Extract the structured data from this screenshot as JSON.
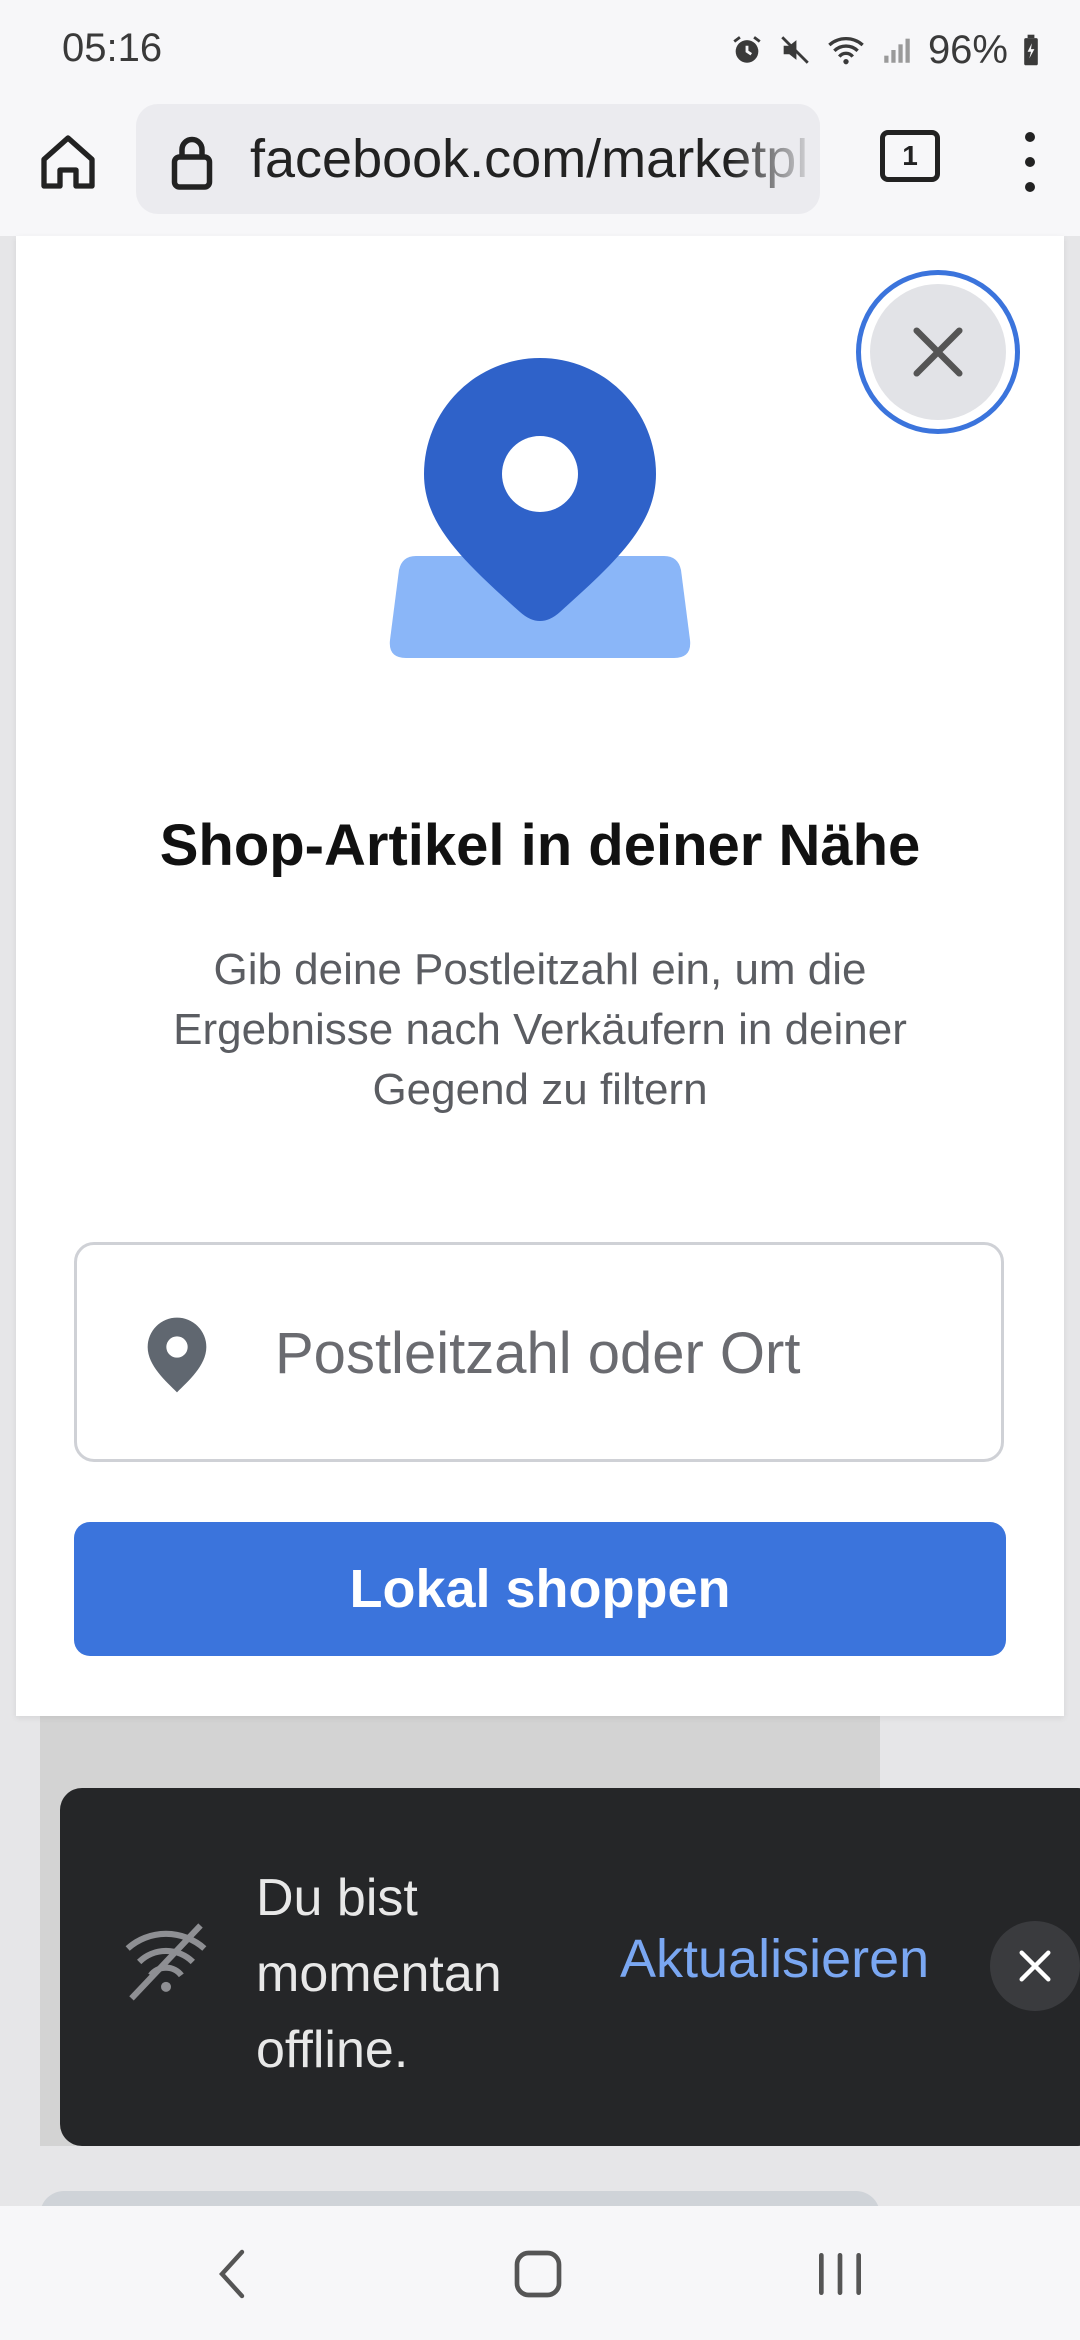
{
  "status_bar": {
    "time": "05:16",
    "battery": "96%",
    "icons": [
      "alarm-icon",
      "mute-icon",
      "wifi-icon",
      "signal-icon",
      "battery-icon"
    ]
  },
  "browser": {
    "url": "facebook.com/marketpl",
    "tab_count": "1",
    "icons": [
      "home-icon",
      "lock-icon",
      "tabs-icon",
      "more-icon"
    ]
  },
  "modal": {
    "title": "Shop-Artikel in deiner Nähe",
    "description": "Gib deine Postleitzahl ein, um die Ergebnisse nach Verkäufern in deiner Gegend zu filtern",
    "zip_placeholder": "Postleitzahl oder Ort",
    "zip_value": "",
    "button_label": "Lokal shoppen",
    "colors": {
      "accent": "#3b74dc",
      "pin_dark": "#2f62c9",
      "pin_light": "#8ab6f8"
    }
  },
  "snackbar": {
    "message": "Du bist momentan offline.",
    "action_label": "Aktualisieren",
    "colors": {
      "background": "#252628",
      "action": "#7aa7f2"
    }
  },
  "nav": {
    "icons": [
      "back-icon",
      "home-icon",
      "recents-icon"
    ]
  }
}
